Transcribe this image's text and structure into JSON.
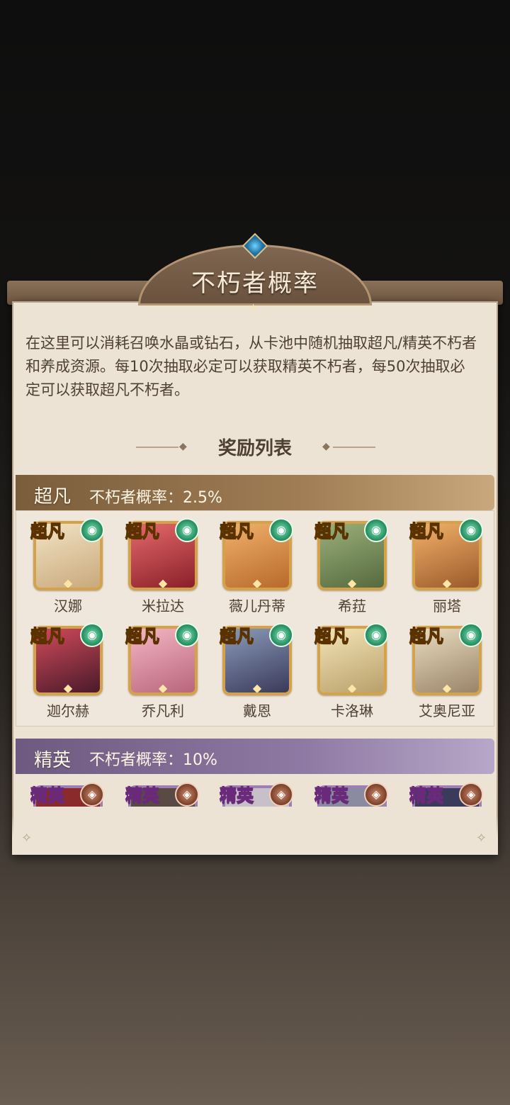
{
  "header": {
    "title": "不朽者概率"
  },
  "description": "在这里可以消耗召唤水晶或钻石，从卡池中随机抽取超凡/精英不朽者和养成资源。每10次抽取必定可以获取精英不朽者，每50次抽取必定可以获取超凡不朽者。",
  "reward_section": {
    "title": "奖励列表"
  },
  "tiers": [
    {
      "name": "超凡",
      "rate_label": "不朽者概率：2.5%",
      "badge": "超凡",
      "color": "#a07d54",
      "characters": [
        "汉娜",
        "米拉达",
        "薇儿丹蒂",
        "希菈",
        "丽塔",
        "迦尔赫",
        "乔凡利",
        "戴恩",
        "卡洛琳",
        "艾奥尼亚"
      ]
    },
    {
      "name": "精英",
      "rate_label": "不朽者概率：10%",
      "badge": "精英",
      "color": "#8e79a3",
      "characters": []
    }
  ]
}
